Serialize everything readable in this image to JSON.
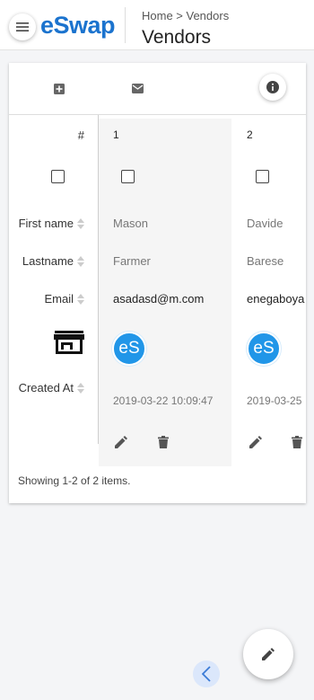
{
  "app": {
    "logo": "eSwap"
  },
  "header": {
    "breadcrumb": "Home > Vendors",
    "title": "Vendors"
  },
  "icons": {
    "menu": "hamburger-menu-icon",
    "add": "add-box-icon",
    "email": "email-icon",
    "info": "info-icon",
    "store": "store-icon",
    "edit": "pencil-icon",
    "delete": "trash-icon",
    "back": "chevron-left-icon"
  },
  "colors": {
    "brand": "#1b73ce",
    "avatar": "#2196e8"
  },
  "table": {
    "labels": {
      "index": "#",
      "first_name": "First name",
      "last_name": "Lastname",
      "email": "Email",
      "created_at": "Created At"
    },
    "rows": [
      {
        "index": "1",
        "first_name": "Mason",
        "last_name": "Farmer",
        "email": "asadasd@m.com",
        "avatar": "eS",
        "created_at": "2019-03-22 10:09:47"
      },
      {
        "index": "2",
        "first_name": "Davide",
        "last_name": "Barese",
        "email": "enegaboya",
        "avatar": "eS",
        "created_at": "2019-03-25"
      }
    ]
  },
  "summary": "Showing 1-2 of 2 items."
}
